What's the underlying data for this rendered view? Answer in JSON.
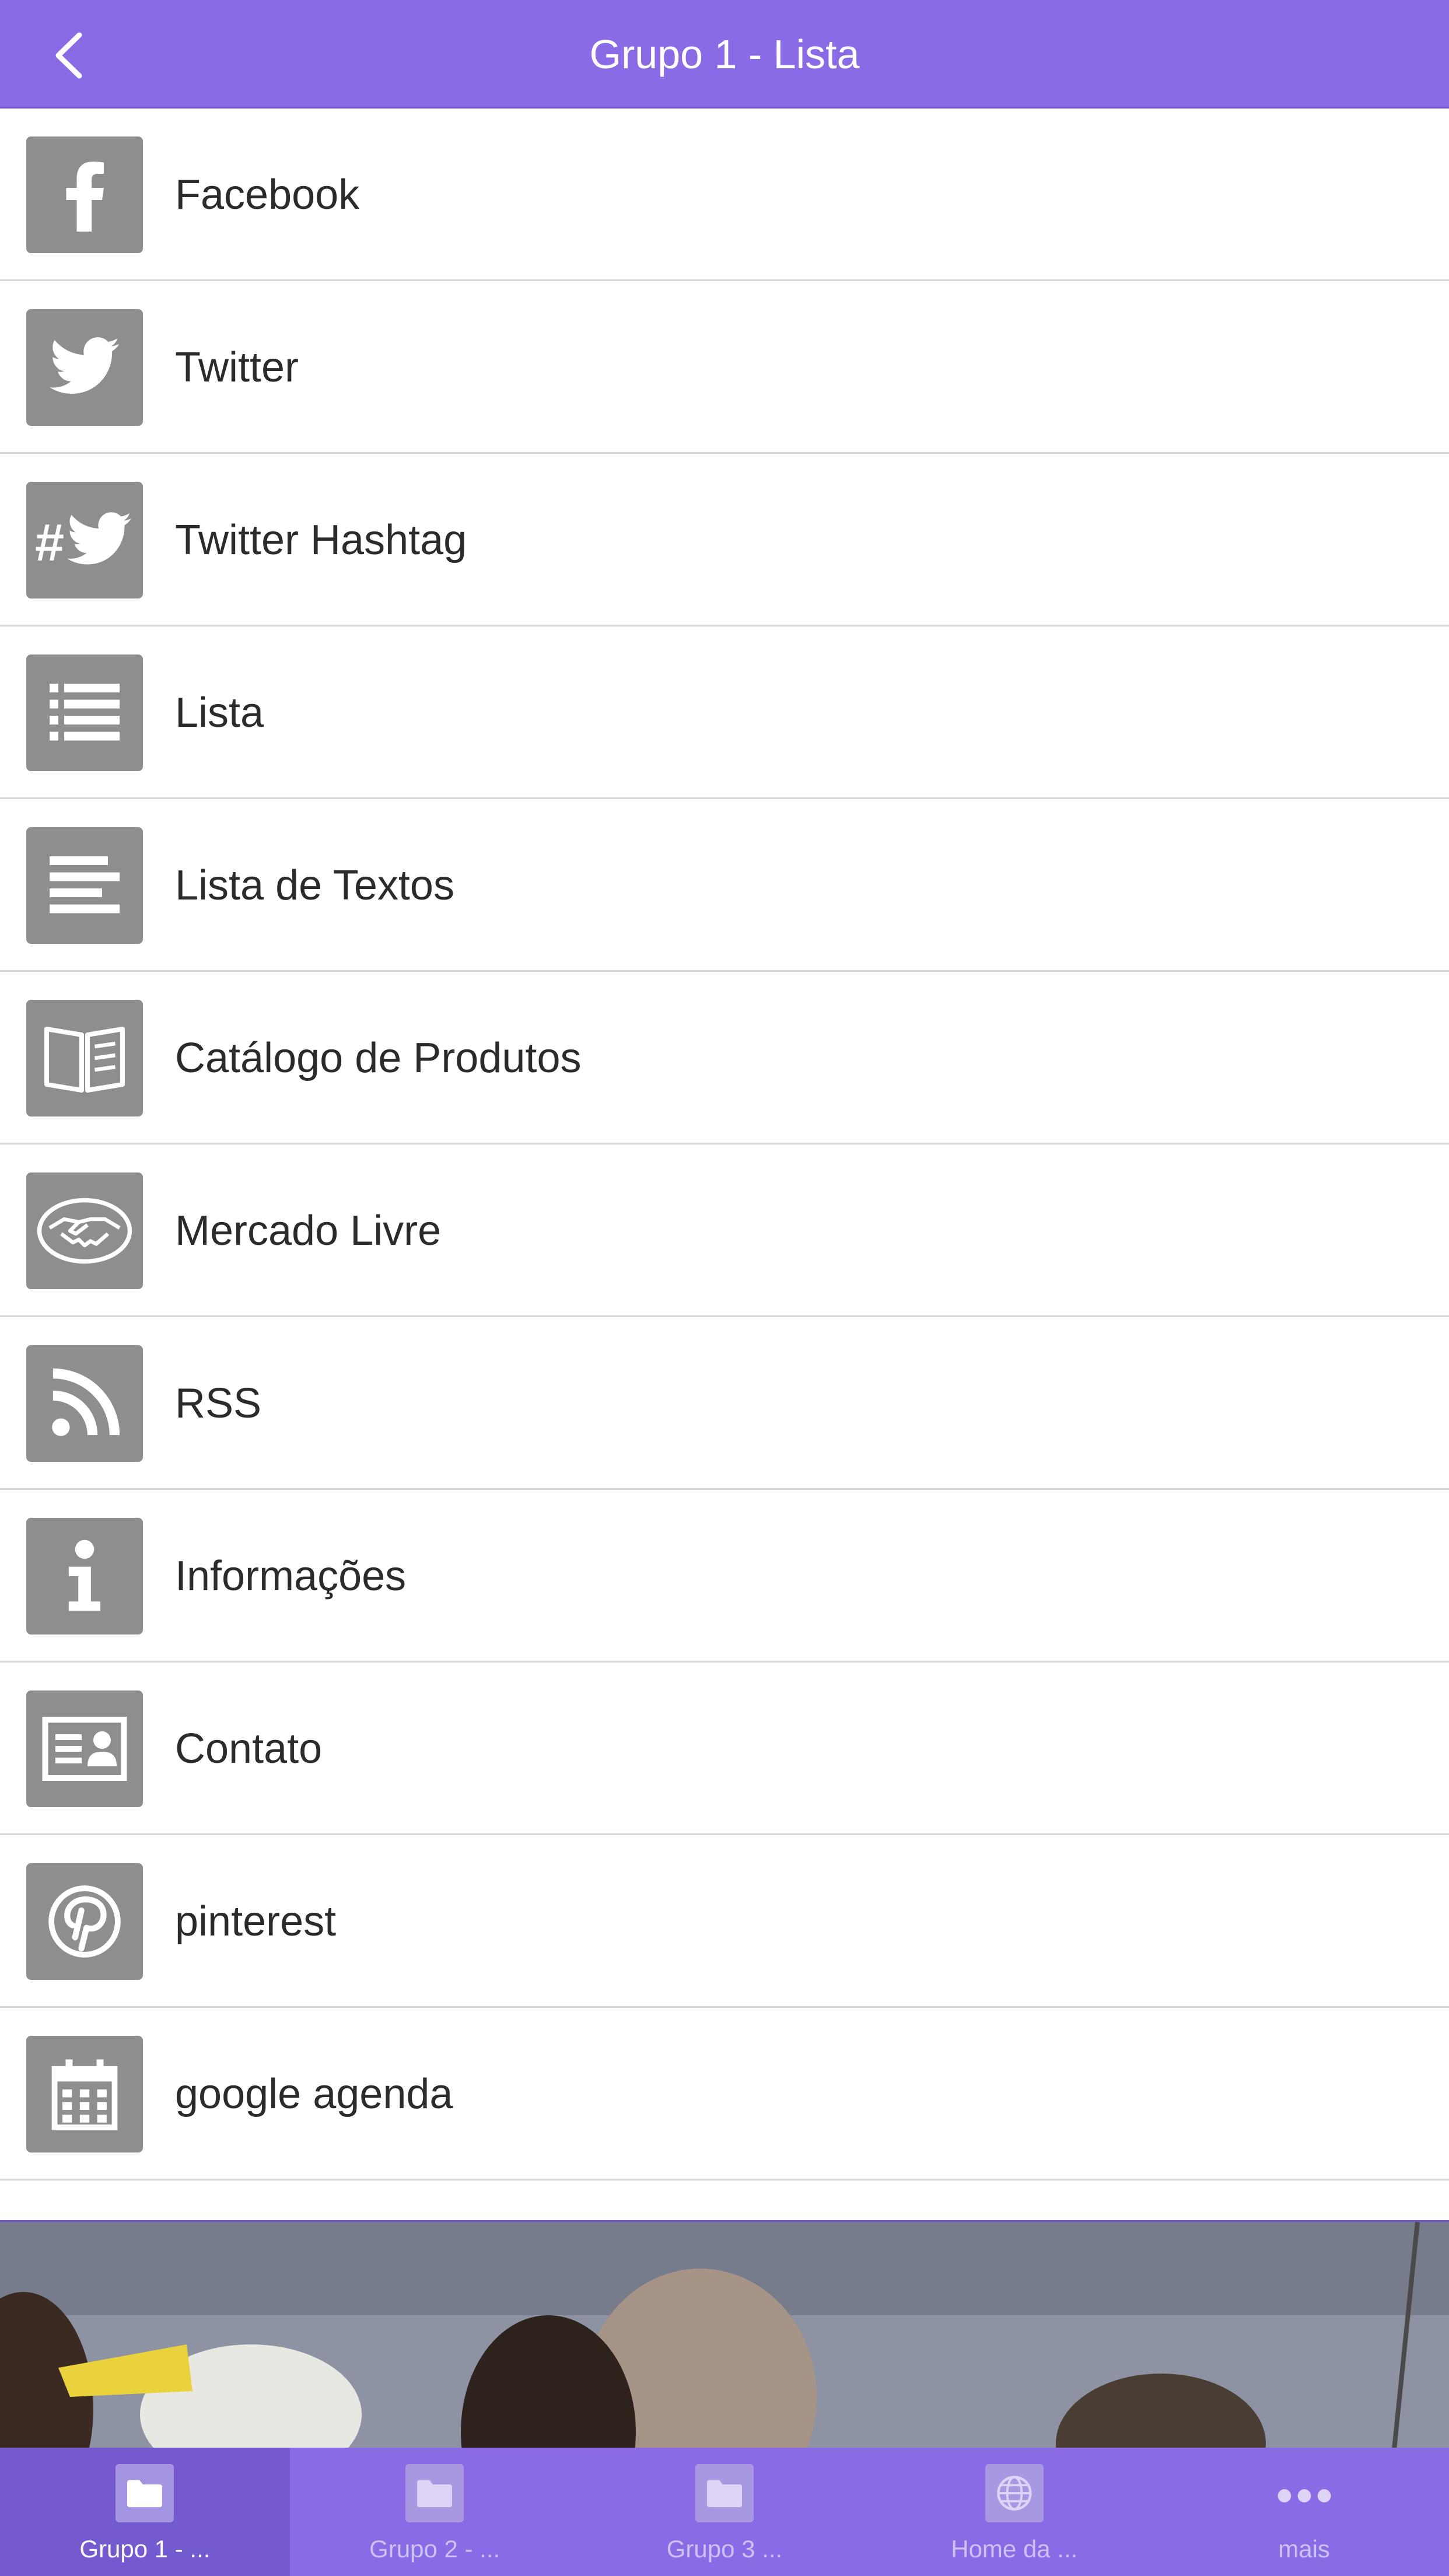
{
  "header": {
    "title": "Grupo 1 - Lista"
  },
  "list": {
    "items": [
      {
        "label": "Facebook",
        "icon": "facebook-icon"
      },
      {
        "label": "Twitter",
        "icon": "twitter-icon"
      },
      {
        "label": "Twitter Hashtag",
        "icon": "twitter-hashtag-icon"
      },
      {
        "label": "Lista",
        "icon": "list-icon"
      },
      {
        "label": "Lista de Textos",
        "icon": "text-lines-icon"
      },
      {
        "label": "Catálogo de Produtos",
        "icon": "catalog-book-icon"
      },
      {
        "label": "Mercado Livre",
        "icon": "handshake-icon"
      },
      {
        "label": "RSS",
        "icon": "rss-icon"
      },
      {
        "label": "Informações",
        "icon": "info-icon"
      },
      {
        "label": "Contato",
        "icon": "contact-card-icon"
      },
      {
        "label": "pinterest",
        "icon": "pinterest-icon"
      },
      {
        "label": "google agenda",
        "icon": "calendar-icon"
      }
    ]
  },
  "tabbar": {
    "tabs": [
      {
        "label": "Grupo 1 - ...",
        "icon": "folder-icon",
        "active": true
      },
      {
        "label": "Grupo 2 - ...",
        "icon": "folder-icon",
        "active": false
      },
      {
        "label": "Grupo 3 ...",
        "icon": "folder-icon",
        "active": false
      },
      {
        "label": "Home da ...",
        "icon": "globe-icon",
        "active": false
      },
      {
        "label": "mais",
        "icon": "more-dots-icon",
        "active": false
      }
    ]
  },
  "colors": {
    "accent": "#896be6",
    "icon_tile": "#8e8e8e"
  }
}
